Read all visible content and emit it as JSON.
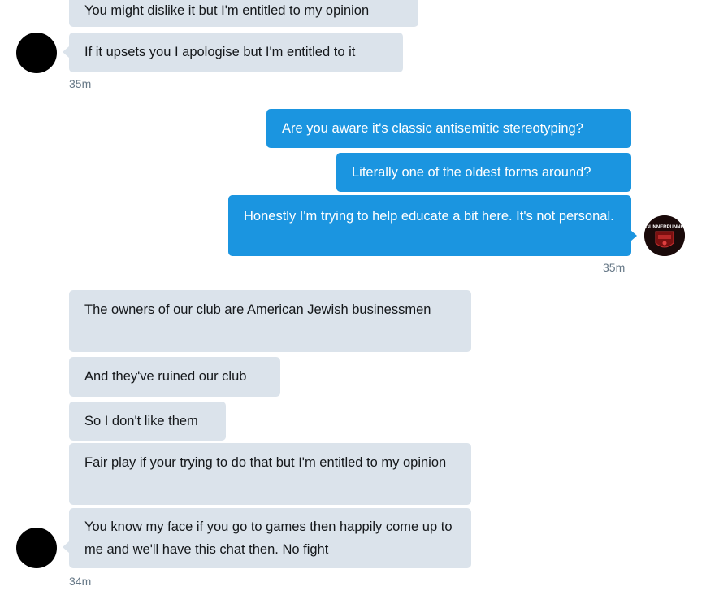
{
  "conversation": {
    "group1": {
      "messages": [
        "You might dislike it but I'm entitled to my opinion",
        "If it upsets you I apologise but I'm entitled to it"
      ],
      "timestamp": "35m"
    },
    "group2": {
      "messages": [
        "Are you aware it's classic antisemitic stereotyping?",
        "Literally one of the oldest forms around?",
        "Honestly I'm trying to help educate a bit here. It's not personal."
      ],
      "timestamp": "35m"
    },
    "group3": {
      "messages": [
        "The owners of our club are American Jewish businessmen",
        "And they've ruined our club",
        "So I don't like them",
        "Fair play if your trying to do that but I'm entitled to my opinion",
        "You know my face if you go to games then happily come up to me and we'll have this chat then. No fight"
      ],
      "timestamp": "34m"
    }
  },
  "avatar_me": {
    "text": "GUNNERPUNNE"
  },
  "colors": {
    "incoming_bubble": "#dbe3eb",
    "outgoing_bubble": "#1b95e0",
    "timestamp": "#657786"
  }
}
